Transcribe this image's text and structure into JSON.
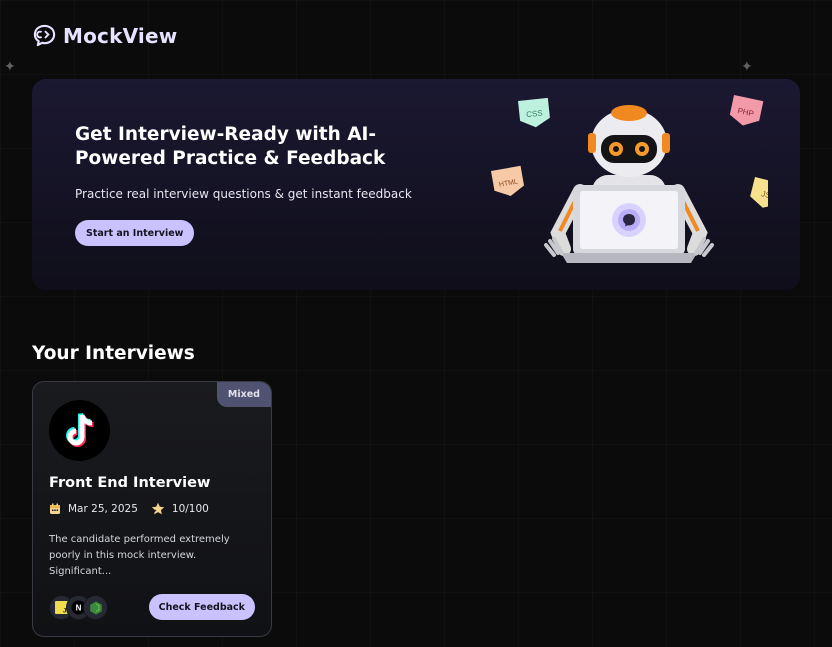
{
  "app": {
    "name": "MockView"
  },
  "hero": {
    "title": "Get Interview-Ready with AI-Powered Practice & Feedback",
    "subtitle": "Practice real interview questions & get instant feedback",
    "cta_label": "Start an Interview",
    "tags": [
      "CSS",
      "PHP",
      "HTML",
      "JS"
    ]
  },
  "interviews_section": {
    "title": "Your Interviews",
    "cards": [
      {
        "type_badge": "Mixed",
        "title": "Front End Interview",
        "date": "Mar 25, 2025",
        "score": "10/100",
        "description": "The candidate performed extremely poorly in this mock interview. Significant...",
        "feedback_label": "Check Feedback",
        "tech_icons": [
          "javascript-icon",
          "nextjs-icon",
          "nodejs-icon"
        ],
        "avatar_icon": "tiktok-icon"
      }
    ]
  },
  "colors": {
    "accent": "#cac2ff",
    "background": "#0b0b0c",
    "badge": "#4f5270"
  }
}
